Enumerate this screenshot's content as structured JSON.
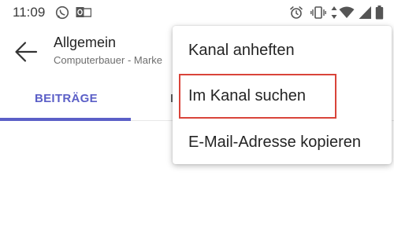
{
  "status_bar": {
    "time": "11:09",
    "icons": [
      "whatsapp-icon",
      "outlook-icon",
      "alarm-icon",
      "vibrate-icon",
      "data-arrows-icon",
      "wifi-icon",
      "signal-icon",
      "battery-icon"
    ]
  },
  "header": {
    "back_icon": "arrow-left-icon",
    "title": "Allgemein",
    "subtitle": "Computerbauer - Marke"
  },
  "tabs": [
    {
      "label": "BEITRÄGE",
      "active": true
    },
    {
      "label": "I",
      "active": false
    }
  ],
  "menu": {
    "items": [
      {
        "label": "Kanal anheften"
      },
      {
        "label": "Im Kanal suchen",
        "highlighted": true
      },
      {
        "label": "E-Mail-Adresse kopieren"
      }
    ]
  },
  "colors": {
    "accent": "#5b5fc7",
    "highlight_border": "#d9443a",
    "text": "#242424",
    "secondary_text": "#6e6e6e"
  }
}
